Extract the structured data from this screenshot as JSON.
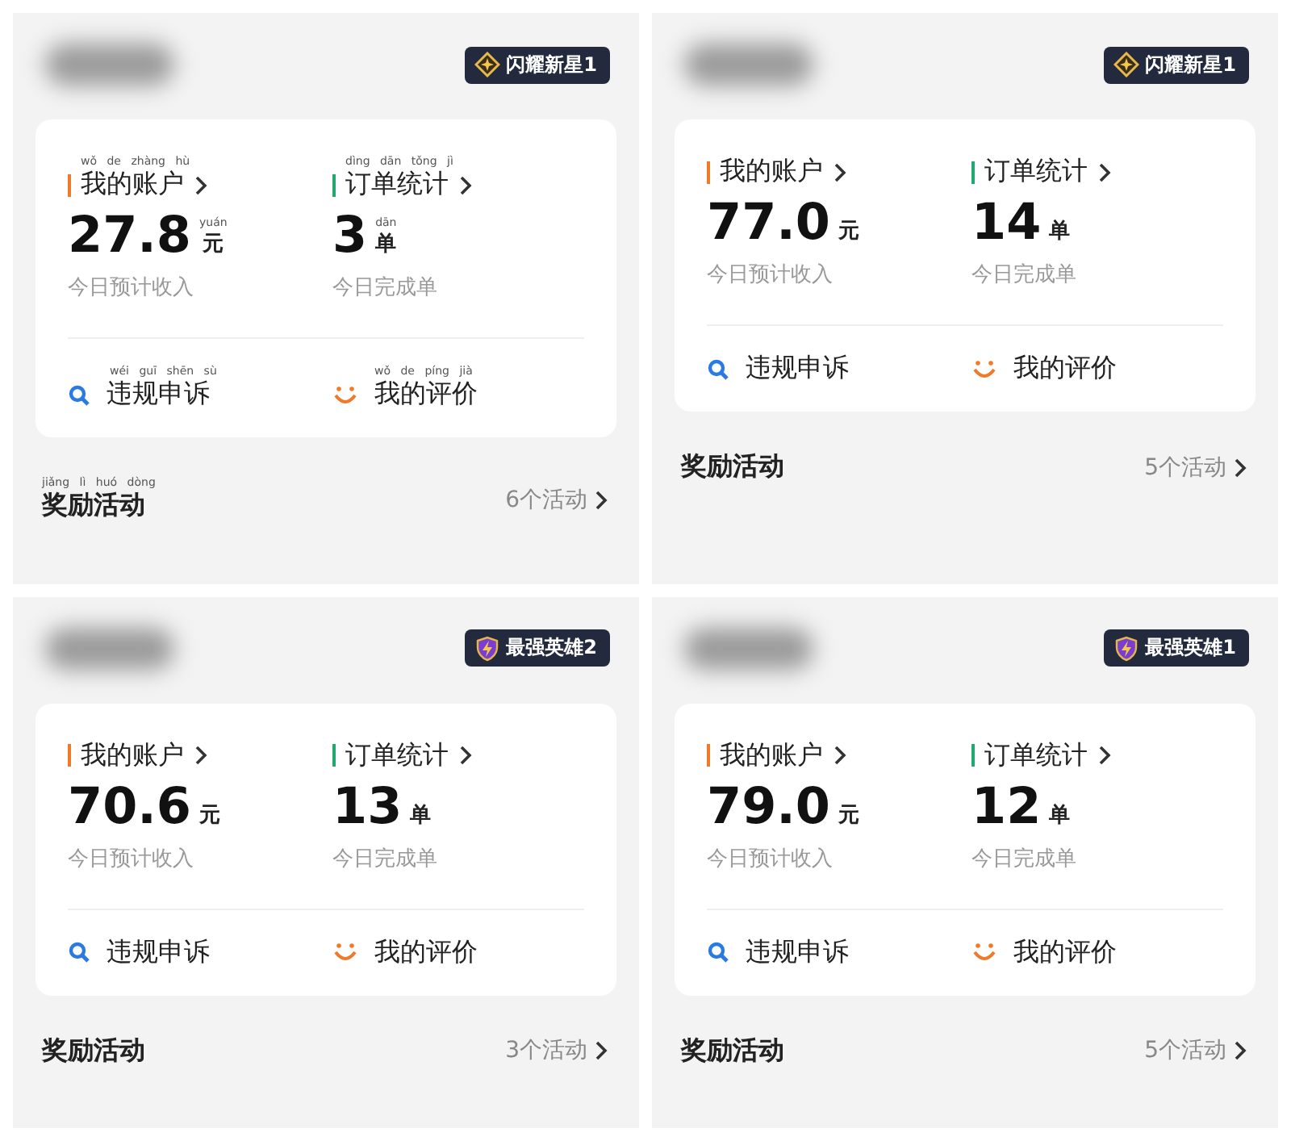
{
  "panels": [
    {
      "badge": {
        "kind": "star",
        "label": "闪耀新星1"
      },
      "account": {
        "label": "我的账户",
        "pinyin": "wǒ de zhàng hù",
        "value": "27.8",
        "unit": "元",
        "unit_pinyin": "yuán",
        "caption": "今日预计收入"
      },
      "orders": {
        "label": "订单统计",
        "pinyin": "dìng dān tǒng jì",
        "value": "3",
        "unit": "单",
        "unit_pinyin": "dān",
        "caption": "今日完成单"
      },
      "links": [
        {
          "kind": "appeal",
          "label": "违规申诉",
          "pinyin": "wéi guī shēn sù"
        },
        {
          "kind": "rating",
          "label": "我的评价",
          "pinyin": "wǒ de píng jià"
        }
      ],
      "rewards": {
        "title": "奖励活动",
        "pinyin": "jiǎng lì huó dòng",
        "count": "6个活动"
      }
    },
    {
      "badge": {
        "kind": "star",
        "label": "闪耀新星1"
      },
      "account": {
        "label": "我的账户",
        "value": "77.0",
        "unit": "元",
        "caption": "今日预计收入"
      },
      "orders": {
        "label": "订单统计",
        "value": "14",
        "unit": "单",
        "caption": "今日完成单"
      },
      "links": [
        {
          "kind": "appeal",
          "label": "违规申诉"
        },
        {
          "kind": "rating",
          "label": "我的评价"
        }
      ],
      "rewards": {
        "title": "奖励活动",
        "count": "5个活动"
      }
    },
    {
      "badge": {
        "kind": "bolt",
        "label": "最强英雄2"
      },
      "account": {
        "label": "我的账户",
        "value": "70.6",
        "unit": "元",
        "caption": "今日预计收入"
      },
      "orders": {
        "label": "订单统计",
        "value": "13",
        "unit": "单",
        "caption": "今日完成单"
      },
      "links": [
        {
          "kind": "appeal",
          "label": "违规申诉"
        },
        {
          "kind": "rating",
          "label": "我的评价"
        }
      ],
      "rewards": {
        "title": "奖励活动",
        "count": "3个活动"
      }
    },
    {
      "badge": {
        "kind": "bolt",
        "label": "最强英雄1"
      },
      "account": {
        "label": "我的账户",
        "value": "79.0",
        "unit": "元",
        "caption": "今日预计收入"
      },
      "orders": {
        "label": "订单统计",
        "value": "12",
        "unit": "单",
        "caption": "今日完成单"
      },
      "links": [
        {
          "kind": "appeal",
          "label": "违规申诉"
        },
        {
          "kind": "rating",
          "label": "我的评价"
        }
      ],
      "rewards": {
        "title": "奖励活动",
        "count": "5个活动"
      }
    }
  ]
}
